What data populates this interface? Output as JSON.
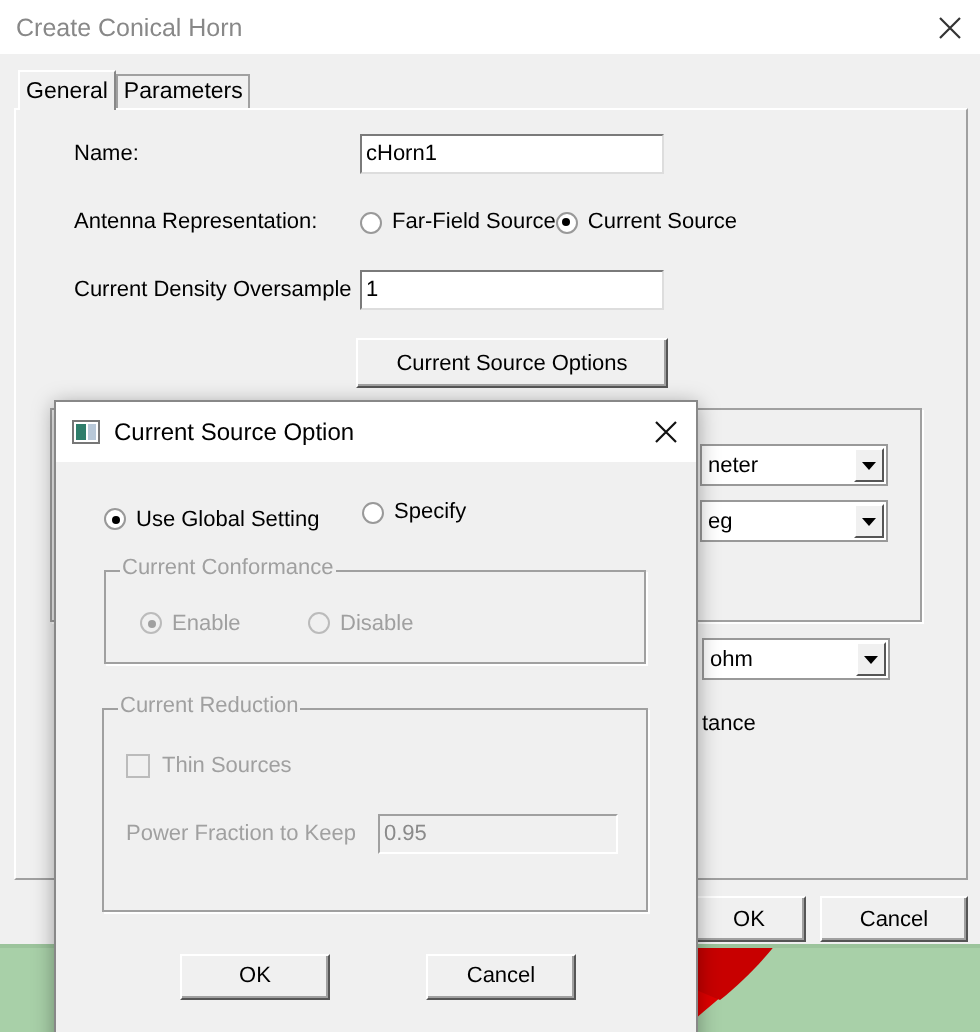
{
  "window": {
    "title": "Create Conical Horn"
  },
  "tabs": [
    {
      "label": "General",
      "selected": true
    },
    {
      "label": "Parameters",
      "selected": false
    }
  ],
  "general": {
    "name_label": "Name:",
    "name_value": "cHorn1",
    "representation_label": "Antenna Representation:",
    "representation_options": [
      {
        "label": "Far-Field Source",
        "selected": false
      },
      {
        "label": "Current Source",
        "selected": true
      }
    ],
    "oversample_label": "Current Density Oversample",
    "oversample_value": "1",
    "options_button": "Current Source Options"
  },
  "hidden_panel": {
    "dropdowns": [
      {
        "value": "neter"
      },
      {
        "value": "eg"
      }
    ],
    "dropdown_below": {
      "value": "ohm"
    },
    "text": "tance"
  },
  "buttons": [
    "OK",
    "Cancel"
  ],
  "dialog": {
    "title": "Current Source Option",
    "mode_options": [
      {
        "label": "Use Global Setting",
        "selected": true
      },
      {
        "label": "Specify",
        "selected": false
      }
    ],
    "conformance": {
      "title": "Current Conformance",
      "disabled": true,
      "options": [
        {
          "label": "Enable",
          "selected": true
        },
        {
          "label": "Disable",
          "selected": false
        }
      ]
    },
    "reduction": {
      "title": "Current Reduction",
      "disabled": true,
      "thin_sources": {
        "label": "Thin Sources",
        "checked": false
      },
      "power_label": "Power Fraction to Keep",
      "power_value": "0.95"
    },
    "buttons": [
      "OK",
      "Cancel"
    ]
  }
}
